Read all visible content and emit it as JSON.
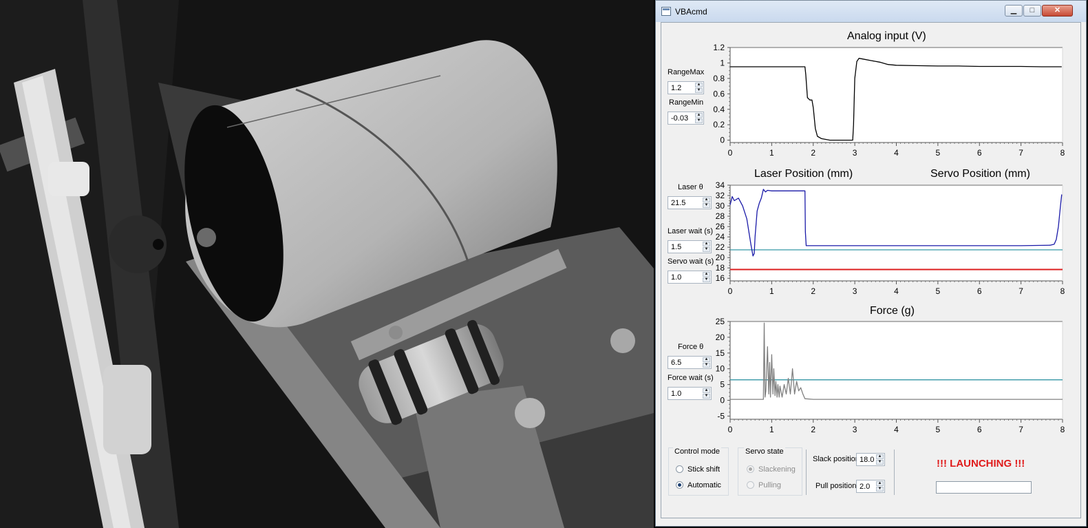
{
  "window": {
    "title": "VBAcmd",
    "minimize_label": "▁",
    "maximize_label": "□",
    "close_label": "✕"
  },
  "analog_chart": {
    "title": "Analog input (V)",
    "line_color": "#000000",
    "chart_data": {
      "type": "line",
      "title": "Analog input (V)",
      "xlim": [
        0,
        8
      ],
      "ylim": [
        -0.03,
        1.2
      ],
      "x_ticks": [
        0,
        1,
        2,
        3,
        4,
        5,
        6,
        7,
        8
      ],
      "y_ticks": [
        0,
        0.2,
        0.4,
        0.6,
        0.8,
        1,
        1.2
      ],
      "series": [
        {
          "color": "#000000",
          "x": [
            0,
            0.5,
            1,
            1.5,
            1.8,
            1.82,
            1.86,
            1.92,
            1.97,
            2.0,
            2.05,
            2.1,
            2.2,
            2.4,
            2.6,
            2.8,
            2.9,
            2.95,
            2.97,
            3.0,
            3.05,
            3.1,
            3.2,
            3.4,
            3.6,
            3.8,
            4.0,
            4.5,
            5,
            5.5,
            6,
            6.5,
            7,
            7.5,
            7.98
          ],
          "y": [
            0.95,
            0.95,
            0.95,
            0.95,
            0.95,
            0.85,
            0.55,
            0.52,
            0.52,
            0.42,
            0.15,
            0.05,
            0.02,
            0.0,
            0.0,
            0.0,
            0.0,
            0.0,
            0.2,
            0.8,
            1.02,
            1.06,
            1.05,
            1.03,
            1.01,
            0.98,
            0.97,
            0.965,
            0.96,
            0.96,
            0.955,
            0.955,
            0.955,
            0.95,
            0.95
          ]
        }
      ]
    }
  },
  "position_chart": {
    "legend_laser": "Laser Position (mm)",
    "legend_servo": "Servo Position (mm)",
    "laser_color": "#1a1aa8",
    "servo_color": "#dd1f1f",
    "threshold_color": "#1f8c9c",
    "chart_data": {
      "type": "line",
      "xlim": [
        0,
        8
      ],
      "ylim": [
        15.5,
        34
      ],
      "x_ticks": [
        0,
        1,
        2,
        3,
        4,
        5,
        6,
        7,
        8
      ],
      "y_ticks": [
        16,
        18,
        20,
        22,
        24,
        26,
        28,
        30,
        32,
        34
      ],
      "threshold": 21.5,
      "series": [
        {
          "name": "Laser Position (mm)",
          "color": "#1a1aa8",
          "x": [
            0,
            0.05,
            0.1,
            0.2,
            0.3,
            0.4,
            0.45,
            0.5,
            0.55,
            0.58,
            0.6,
            0.65,
            0.7,
            0.75,
            0.8,
            0.85,
            0.9,
            1.0,
            1.2,
            1.5,
            1.8,
            1.81,
            1.83,
            2.5,
            3,
            4,
            5,
            6,
            7,
            7.7,
            7.8,
            7.85,
            7.9,
            7.95,
            7.98
          ],
          "y": [
            30.2,
            31.8,
            31.0,
            31.5,
            30.0,
            27.5,
            25.0,
            22.5,
            20.3,
            20.8,
            24,
            29,
            30.5,
            31.5,
            33.2,
            32.7,
            33.0,
            32.9,
            32.9,
            32.9,
            32.9,
            25,
            22.3,
            22.3,
            22.3,
            22.3,
            22.3,
            22.3,
            22.3,
            22.4,
            22.6,
            23.5,
            26,
            30,
            32.2
          ]
        },
        {
          "name": "Servo Position (mm)",
          "color": "#dd1f1f",
          "x": [
            0,
            8
          ],
          "y": [
            17.7,
            17.7
          ]
        }
      ]
    }
  },
  "force_chart": {
    "title": "Force (g)",
    "trace_color": "#808080",
    "threshold_color": "#1f8c9c",
    "chart_data": {
      "type": "line",
      "title": "Force (g)",
      "xlim": [
        0,
        8
      ],
      "ylim": [
        -6,
        25
      ],
      "x_ticks": [
        0,
        1,
        2,
        3,
        4,
        5,
        6,
        7,
        8
      ],
      "y_ticks": [
        -5,
        0,
        5,
        10,
        15,
        20,
        25
      ],
      "threshold": 6.5,
      "series": [
        {
          "color": "#808080",
          "x": [
            0,
            0.5,
            0.8,
            0.82,
            0.84,
            0.86,
            0.9,
            0.93,
            0.95,
            0.97,
            1.0,
            1.03,
            1.05,
            1.08,
            1.1,
            1.13,
            1.15,
            1.18,
            1.2,
            1.25,
            1.3,
            1.35,
            1.4,
            1.45,
            1.5,
            1.55,
            1.6,
            1.65,
            1.7,
            1.75,
            1.8,
            2,
            3,
            4,
            5,
            6,
            7,
            8
          ],
          "y": [
            0.3,
            0.3,
            0.3,
            24.5,
            1,
            3,
            17,
            2,
            12,
            1,
            14.5,
            2,
            10,
            1.5,
            6,
            1,
            5,
            1,
            4.5,
            1,
            5,
            2,
            7,
            2,
            10,
            2,
            6,
            3,
            4,
            2,
            0.5,
            0.3,
            0.3,
            0.3,
            0.3,
            0.3,
            0.3,
            0.3
          ]
        }
      ]
    }
  },
  "controls": {
    "range_max_label": "RangeMax",
    "range_max_value": "1.2",
    "range_min_label": "RangeMin",
    "range_min_value": "-0.03",
    "laser_theta_label": "Laser θ",
    "laser_theta_value": "21.5",
    "laser_wait_label": "Laser wait (s)",
    "laser_wait_value": "1.5",
    "servo_wait_label": "Servo wait (s)",
    "servo_wait_value": "1.0",
    "force_theta_label": "Force θ",
    "force_theta_value": "6.5",
    "force_wait_label": "Force wait (s)",
    "force_wait_value": "1.0",
    "spin_up": "▲",
    "spin_down": "▼"
  },
  "control_mode": {
    "title": "Control mode",
    "options": [
      "Stick shift",
      "Automatic"
    ],
    "selected": "Automatic"
  },
  "servo_state": {
    "title": "Servo state",
    "options": [
      "Slackening",
      "Pulling"
    ],
    "selected": "Slackening"
  },
  "positions": {
    "slack_label": "Slack position",
    "slack_value": "18.0",
    "pull_label": "Pull position",
    "pull_value": "2.0"
  },
  "status": {
    "launch_text": "!!! LAUNCHING !!!",
    "progress": 0.0
  }
}
